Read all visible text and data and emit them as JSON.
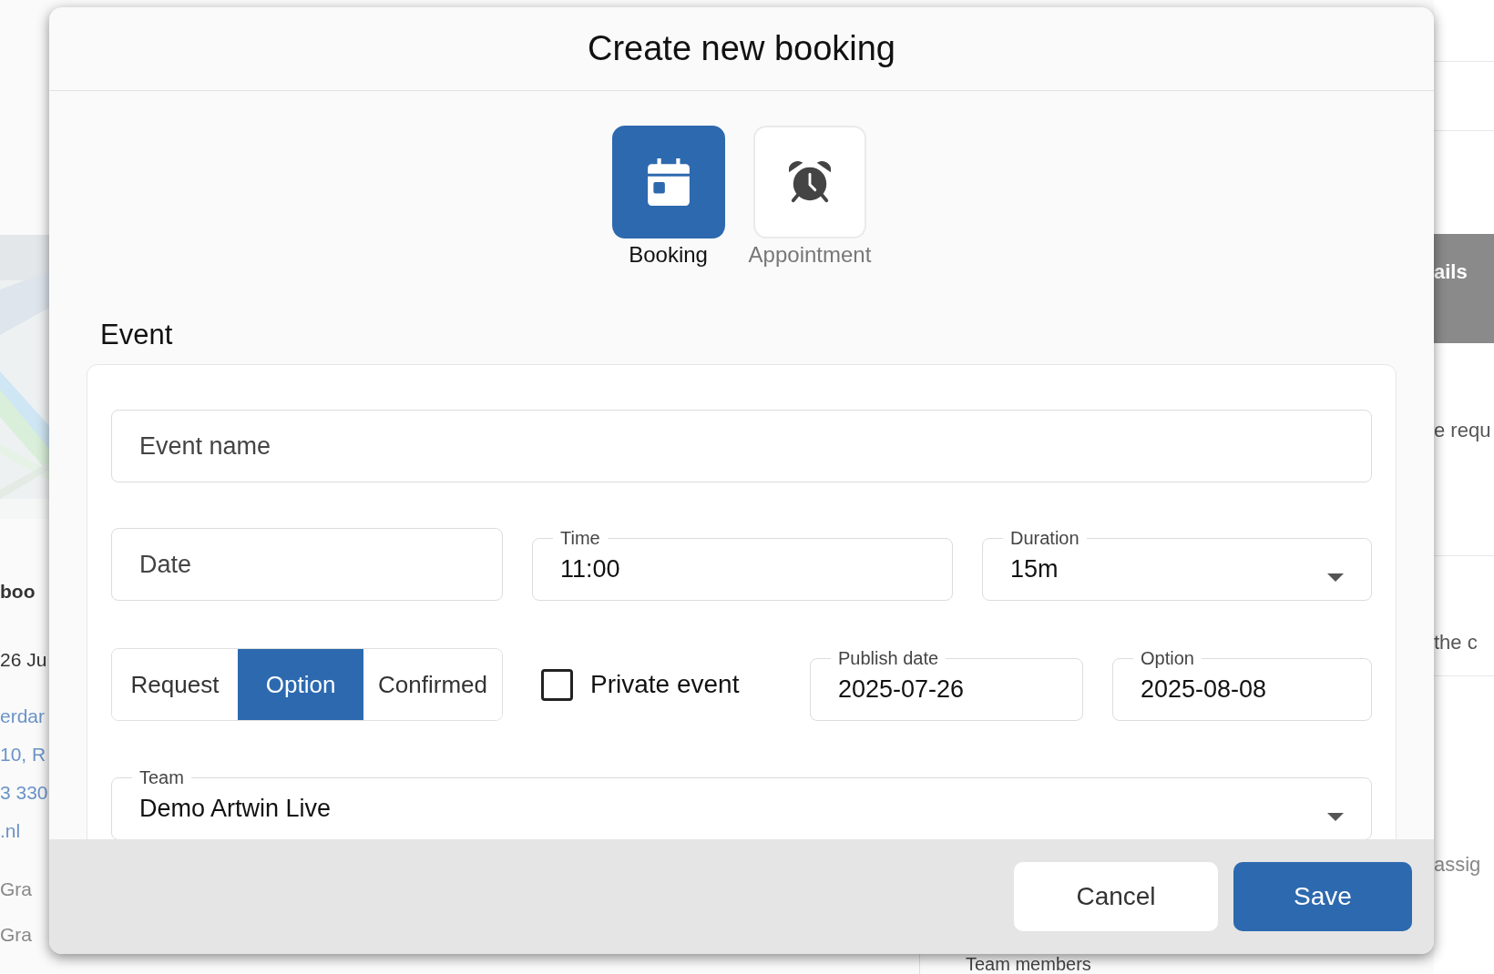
{
  "background_page": {
    "left_texts": [
      {
        "text": "boo",
        "kind": "heading"
      },
      {
        "text": "26 Ju",
        "kind": "text"
      },
      {
        "text": "erdar",
        "kind": "link"
      },
      {
        "text": "10, R",
        "kind": "link"
      },
      {
        "text": "3 330",
        "kind": "link"
      },
      {
        "text": ".nl",
        "kind": "link"
      },
      {
        "text": "Gra",
        "kind": "muted"
      },
      {
        "text": "Gra",
        "kind": "muted"
      }
    ],
    "right_header": "ails",
    "right_texts": [
      {
        "text": "e requ"
      },
      {
        "text": "the c"
      },
      {
        "text": "assig"
      }
    ],
    "bottom_heading": "Team members"
  },
  "dialog": {
    "title": "Create new booking",
    "types": [
      {
        "label": "Booking",
        "kind": "calendar",
        "selected": true
      },
      {
        "label": "Appointment",
        "kind": "alarm",
        "selected": false
      }
    ],
    "section": "Event",
    "event_name": {
      "placeholder": "Event name"
    },
    "date": {
      "placeholder": "Date"
    },
    "time": {
      "label": "Time",
      "value": "11:00"
    },
    "duration": {
      "label": "Duration",
      "value": "15m"
    },
    "status": [
      {
        "label": "Request",
        "selected": false
      },
      {
        "label": "Option",
        "selected": true
      },
      {
        "label": "Confirmed",
        "selected": false
      }
    ],
    "private_event": {
      "label": "Private event",
      "checked": false
    },
    "publish_date": {
      "label": "Publish date",
      "value": "2025-07-26"
    },
    "option": {
      "label": "Option",
      "value": "2025-08-08"
    },
    "team": {
      "label": "Team",
      "value": "Demo Artwin Live"
    },
    "buttons": [
      {
        "label": "Cancel",
        "kind": "secondary"
      },
      {
        "label": "Save",
        "kind": "primary"
      }
    ]
  }
}
